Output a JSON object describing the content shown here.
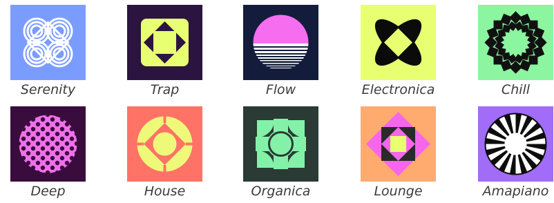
{
  "genres": [
    {
      "label": "Serenity",
      "icon": "interlaced-knot-icon",
      "bg": "#7b9cff",
      "fg": "#ffffff"
    },
    {
      "label": "Trap",
      "icon": "nested-squares-icon",
      "bg": "#2c1440",
      "fg": "#e8ff72"
    },
    {
      "label": "Flow",
      "icon": "striped-sun-icon",
      "bg": "#131d3b",
      "fg": "#f66df0"
    },
    {
      "label": "Electronica",
      "icon": "four-petal-icon",
      "bg": "#e8ff72",
      "fg": "#0b0b0b"
    },
    {
      "label": "Chill",
      "icon": "sunburst-ring-icon",
      "bg": "#8bf59f",
      "fg": "#111111"
    },
    {
      "label": "Deep",
      "icon": "petal-pattern-circle-icon",
      "bg": "#3a0c3e",
      "fg": "#f070ea"
    },
    {
      "label": "House",
      "icon": "quatrefoil-circle-icon",
      "bg": "#ff7266",
      "fg": "#eef97a"
    },
    {
      "label": "Organica",
      "icon": "segmented-circle-icon",
      "bg": "#2a3a34",
      "fg": "#83f2a8"
    },
    {
      "label": "Lounge",
      "icon": "diamond-square-icon",
      "bg": "#ffab70",
      "fg": "#f566ec"
    },
    {
      "label": "Amapiano",
      "icon": "radial-burst-icon",
      "bg": "#a06cf8",
      "fg": "#0d0d0d"
    }
  ]
}
